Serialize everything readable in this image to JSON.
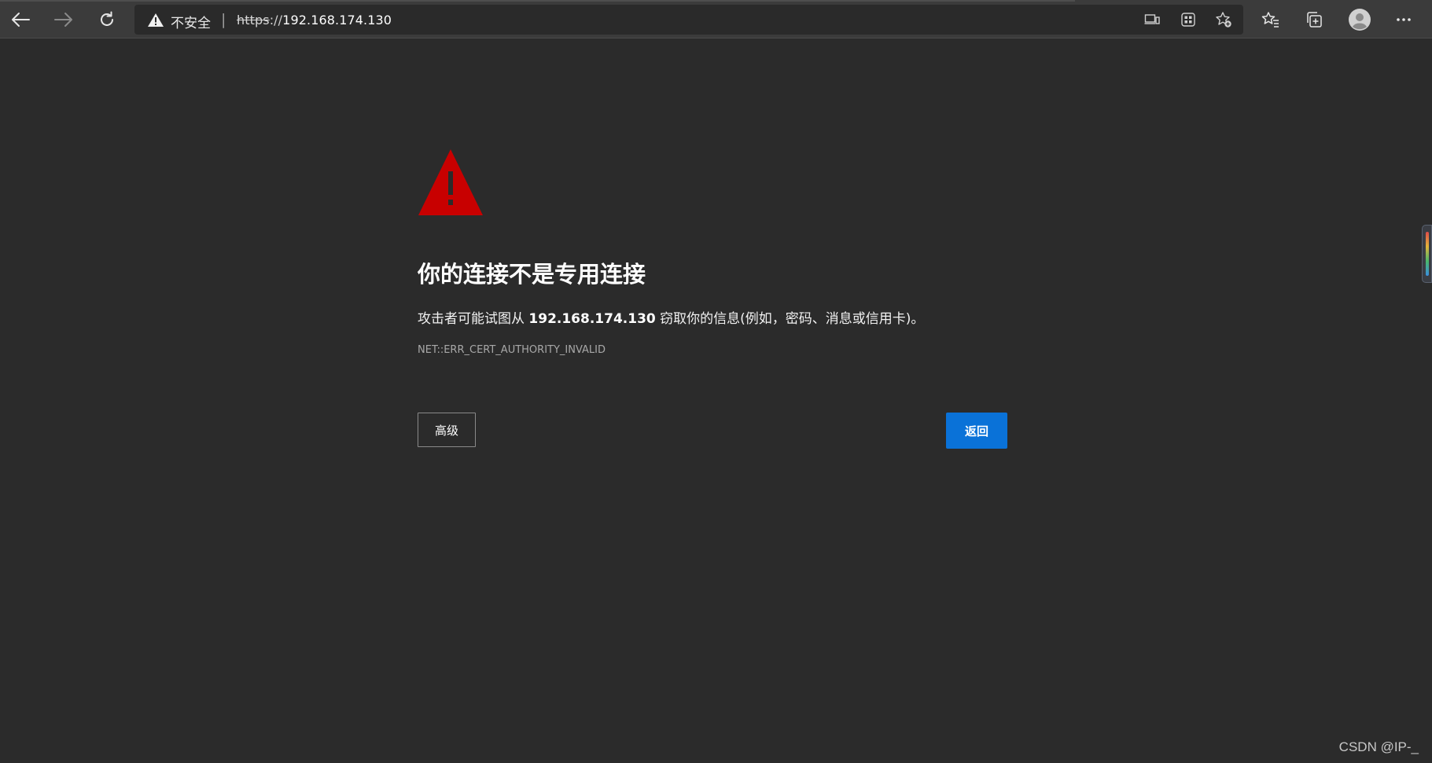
{
  "toolbar": {
    "back_icon": "back-arrow-icon",
    "forward_icon": "forward-arrow-icon",
    "refresh_icon": "refresh-icon",
    "security_label": "不安全",
    "separator": "|",
    "url_scheme": "https",
    "url_rest": "://",
    "url_host": "192.168.174.130",
    "address_icons": [
      "cast-device-icon",
      "apps-grid-icon",
      "add-favorite-icon"
    ],
    "right_icons": [
      "favorites-icon",
      "collections-icon",
      "profile-avatar-icon",
      "more-options-icon"
    ]
  },
  "colors": {
    "page_bg": "#2b2b2b",
    "toolbar_bg": "#3b3b3b",
    "address_bg": "#2a2a2a",
    "warning_red": "#c80000",
    "primary_button": "#0a72d8"
  },
  "main": {
    "warning_icon": "warning-triangle-icon",
    "headline": "你的连接不是专用连接",
    "desc_prefix": "攻击者可能试图从 ",
    "desc_host": "192.168.174.130",
    "desc_suffix": " 窃取你的信息(例如，密码、消息或信用卡)。",
    "error_code": "NET::ERR_CERT_AUTHORITY_INVALID",
    "advanced_button": "高级",
    "back_button": "返回"
  },
  "watermark": "CSDN @IP-_"
}
